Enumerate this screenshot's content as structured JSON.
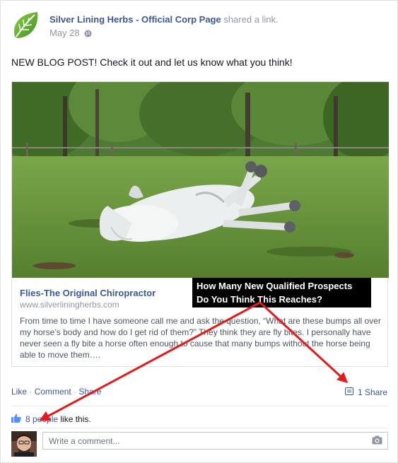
{
  "post": {
    "author": "Silver Lining Herbs - Official Corp Page",
    "action": " shared a link.",
    "date": "May 28",
    "text": "NEW BLOG POST! Check it out and let us know what you think!"
  },
  "link": {
    "title": "Flies-The Original Chiropractor",
    "url": "www.silverliningherbs.com",
    "description": "From time to time I have someone call me and ask the question, “What are these bumps all over my horse’s body and how do I get rid of them?” They think they are fly bites. I personally have never seen a fly bite a horse often enough to cause that many bumps without the horse being able to move them…."
  },
  "callout": {
    "line1": "How Many New Qualified Prospects",
    "line2": "Do You Think This Reaches?"
  },
  "actions": {
    "like": "Like",
    "sep1": " · ",
    "comment": "Comment",
    "sep2": " · ",
    "share": "Share",
    "share_count": "1 Share"
  },
  "likes": {
    "count_people": "8 people",
    "suffix": " like this."
  },
  "comment": {
    "placeholder": "Write a comment..."
  },
  "colors": {
    "link_blue": "#3b5998",
    "arrow_red": "#e21b1b",
    "callout_bg": "#000000"
  }
}
